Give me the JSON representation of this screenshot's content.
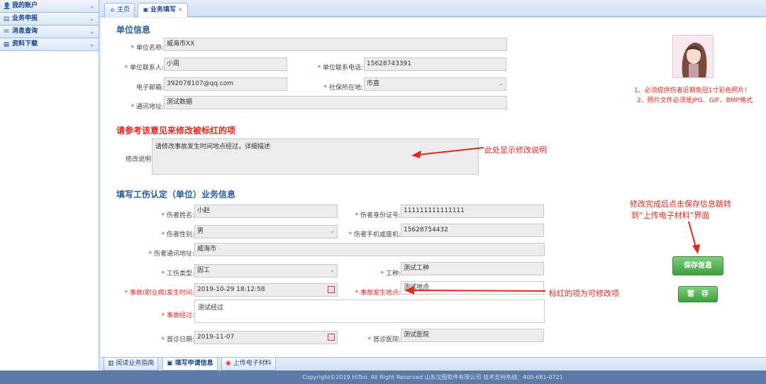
{
  "sidebar": {
    "items": [
      {
        "label": "我的账户",
        "icon": "user-icon"
      },
      {
        "label": "业务申报",
        "icon": "folder-icon"
      },
      {
        "label": "消息查询",
        "icon": "mail-icon"
      },
      {
        "label": "资料下载",
        "icon": "document-icon"
      }
    ]
  },
  "tabs": [
    {
      "label": "主页"
    },
    {
      "label": "业务填写",
      "close": "×"
    }
  ],
  "unit": {
    "title": "单位信息",
    "name_label": "单位名称:",
    "name_value": "威海市XX",
    "contact_label": "单位联系人:",
    "contact_value": "小周",
    "phone_label": "单位联系电话:",
    "phone_value": "15628743391",
    "email_label": "电子邮箱:",
    "email_value": "392078107@qq.com",
    "social_label": "社保所在地:",
    "social_value": "市直",
    "address_label": "通讯地址:",
    "address_value": "测试数据"
  },
  "revision": {
    "title": "请参考该意见来修改被标红的项",
    "label": "修改说明:",
    "value": "请修改事故发生时间地点经过，详细描述",
    "annotation": "此处显示修改说明"
  },
  "business": {
    "title": "填写工伤认定（单位）业务信息",
    "injured_name_label": "伤者姓名:",
    "injured_name_value": "小赵",
    "id_label": "伤者身份证号:",
    "id_value": "111111111111111",
    "gender_label": "伤者性别:",
    "gender_value": "男",
    "mobile_label": "伤者手机或座机:",
    "mobile_value": "15628754432",
    "injured_address_label": "伤者通讯地址:",
    "injured_address_value": "威海市",
    "injury_type_label": "工伤类型:",
    "injury_type_value": "因工",
    "work_type_label": "工种:",
    "work_type_value": "测试工种",
    "accident_time_label": "事故(职业病)发生时间:",
    "accident_time_value": "2019-10-29 18:12:58",
    "accident_place_label": "事故发生地点:",
    "accident_place_value": "测试地点",
    "accident_process_label": "事故经过:",
    "accident_process_value": "测试经过",
    "first_visit_date_label": "首诊日期:",
    "first_visit_date_value": "2019-11-07",
    "hospital_label": "首诊医院:",
    "hospital_value": "测试医院",
    "annotation_red": "标红的项为可修改项"
  },
  "photo_notes": {
    "line1": "1、必须提供伤者近期免冠1寸彩色照片！",
    "line2": "2、照片文件必须是JPG、GIF、BMP格式"
  },
  "save_note": {
    "line1": "修改完成后点击保存信息跳转",
    "line2": "到“上传电子材料”界面"
  },
  "buttons": {
    "save": "保存信息",
    "temp": "暂　存"
  },
  "bottom_tabs": [
    {
      "label": "阅读业务指南"
    },
    {
      "label": "填写申请信息"
    },
    {
      "label": "上传电子材料"
    }
  ],
  "footer": "Copyright©2019 HiToo. All Right Reserved 山东汉图软件有限公司 技术支持热线：400-681-0721"
}
